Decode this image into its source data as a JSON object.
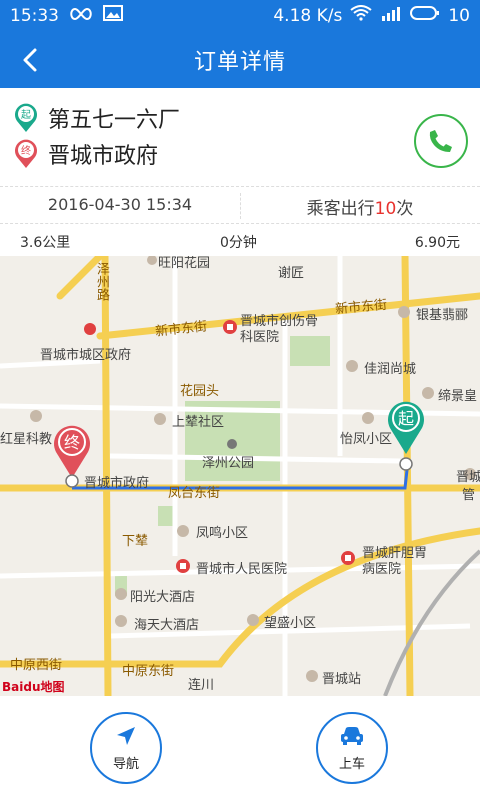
{
  "status": {
    "time": "15:33",
    "speed": "4.18 K/s",
    "battery": "10"
  },
  "header": {
    "title": "订单详情"
  },
  "route": {
    "start_badge": "起",
    "end_badge": "终",
    "start": "第五七一六厂",
    "end": "晋城市政府"
  },
  "info": {
    "date": "2016-04-30 15:34",
    "trips_prefix": "乘客出行",
    "trips_count": "10",
    "trips_suffix": "次"
  },
  "stats": {
    "distance": "3.6公里",
    "duration": "0分钟",
    "fare": "6.90元"
  },
  "map": {
    "labels": {
      "zezhou_road": "泽州路",
      "xieju": "谢匠",
      "xinshi_east_1": "新市东街",
      "xinshi_east_2": "新市东街",
      "chengqu_gov": "晋城市城区政府",
      "chuangshang": "晋城市创伤骨科医院",
      "yinji": "银基翡郦",
      "jiarun": "佳润尚城",
      "diejing": "缔景皇",
      "huayuantou": "花园头",
      "shangzhuang": "上辇社区",
      "zezhou_park": "泽州公园",
      "yifeng": "怡凤小区",
      "hongxing": "红星科教",
      "city_gov": "晋城市政府",
      "fengtai": "凤台东街",
      "jincheng_r": "晋城",
      "guan": "管",
      "fengming": "凤鸣小区",
      "xiazhuang": "下辇",
      "renmin": "晋城市人民医院",
      "gandan": "晋城肝胆胃病医院",
      "yangguang": "阳光大酒店",
      "haitian": "海天大酒店",
      "wangsheng": "望盛小区",
      "zhongyuan_west": "中原西街",
      "zhongyuan_east": "中原东街",
      "lianchuan": "连川",
      "station": "晋城站",
      "wangyang": "旺阳花园"
    },
    "logo": "Baidu地图"
  },
  "actions": {
    "navigate": "导航",
    "board": "上车"
  },
  "colors": {
    "accent": "#1a78dc",
    "start": "#1aa98c",
    "end": "#e0505a",
    "phone": "#39b54a",
    "highlight": "#e8322e"
  }
}
